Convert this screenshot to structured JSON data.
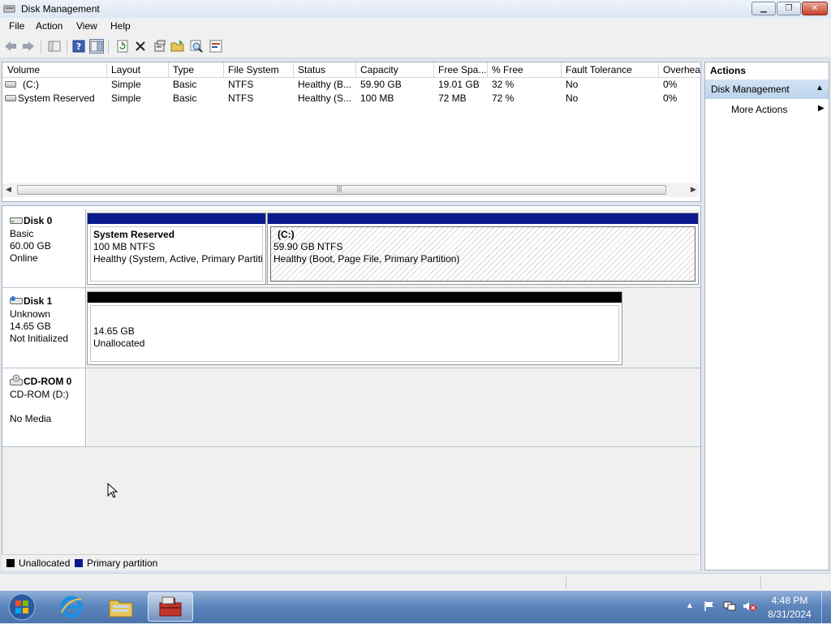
{
  "window": {
    "title": "Disk Management"
  },
  "menu": [
    "File",
    "Action",
    "View",
    "Help"
  ],
  "volume_table": {
    "headers": [
      "Volume",
      "Layout",
      "Type",
      "File System",
      "Status",
      "Capacity",
      "Free Spa...",
      "% Free",
      "Fault Tolerance",
      "Overhea"
    ],
    "rows": [
      [
        "(C:)",
        "Simple",
        "Basic",
        "NTFS",
        "Healthy (B...",
        "59.90 GB",
        "19.01 GB",
        "32 %",
        "No",
        "0%"
      ],
      [
        "System Reserved",
        "Simple",
        "Basic",
        "NTFS",
        "Healthy (S...",
        "100 MB",
        "72 MB",
        "72 %",
        "No",
        "0%"
      ]
    ]
  },
  "disks": [
    {
      "name": "Disk 0",
      "type": "Basic",
      "size": "60.00 GB",
      "state": "Online",
      "partitions": [
        {
          "name": "System Reserved",
          "size": "100 MB NTFS",
          "status": "Healthy (System, Active, Primary Partiti"
        },
        {
          "name": "(C:)",
          "size": "59.90 GB NTFS",
          "status": "Healthy (Boot, Page File, Primary Partition)"
        }
      ]
    },
    {
      "name": "Disk 1",
      "type": "Unknown",
      "size": "14.65 GB",
      "state": "Not Initialized",
      "partitions": [
        {
          "size": "14.65 GB",
          "status": "Unallocated"
        }
      ]
    },
    {
      "name": "CD-ROM 0",
      "type": "CD-ROM (D:)",
      "state": "No Media"
    }
  ],
  "legend": {
    "unallocated": "Unallocated",
    "primary": "Primary partition"
  },
  "actions": {
    "title": "Actions",
    "section": "Disk Management",
    "more": "More Actions"
  },
  "clock": {
    "time": "4:48 PM",
    "date": "8/31/2024"
  },
  "colors": {
    "primary_partition": "#0a1a8c",
    "unallocated": "#000000",
    "actions_header": "#c6daf0"
  },
  "icons": [
    "back-icon",
    "forward-icon",
    "console-tree-icon",
    "help-icon",
    "show-hide-icon",
    "refresh-icon",
    "delete-icon",
    "properties-icon",
    "open-icon",
    "explore-icon",
    "help-topic-icon"
  ]
}
